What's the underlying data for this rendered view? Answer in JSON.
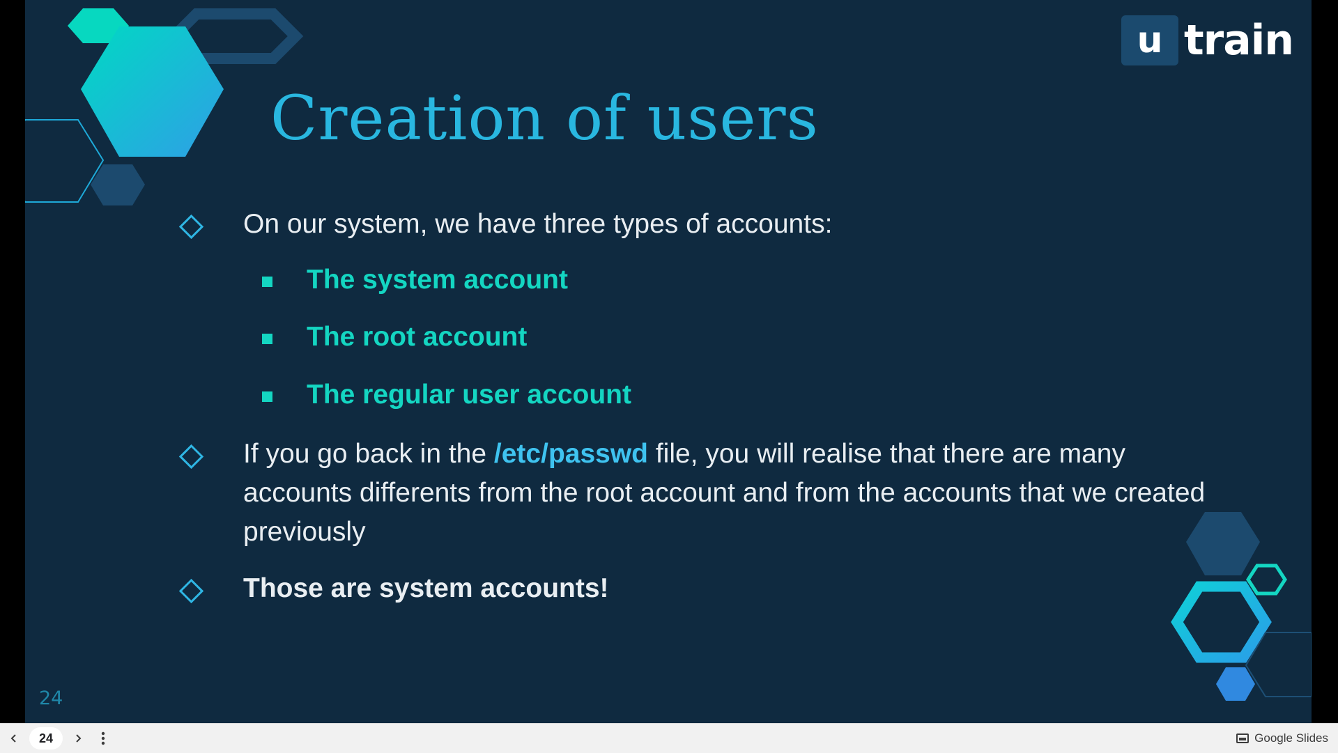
{
  "slide": {
    "logo": {
      "box_letter": "u",
      "text": "train"
    },
    "title": "Creation of users",
    "bullets": [
      {
        "text": "On our system, we have three types of accounts:"
      },
      {
        "pre": "If you go back in the ",
        "highlight": "/etc/passwd",
        "post": " file, you will realise that there are many accounts differents from the root account and from the accounts that we created previously"
      },
      {
        "text": "Those are system accounts!"
      }
    ],
    "sub_items": [
      "The system account",
      "The root account",
      "The regular user account"
    ],
    "page_number": "24"
  },
  "toolbar": {
    "prev_icon": "chevron-left-icon",
    "next_icon": "chevron-right-icon",
    "current_page": "24",
    "more_icon": "more-vert-icon",
    "brand_label": "Google Slides"
  },
  "colors": {
    "background": "#0f2a40",
    "title": "#29b7e0",
    "accent": "#14d6c2",
    "body_text": "#e9eef2",
    "highlight": "#3fc3f0"
  }
}
